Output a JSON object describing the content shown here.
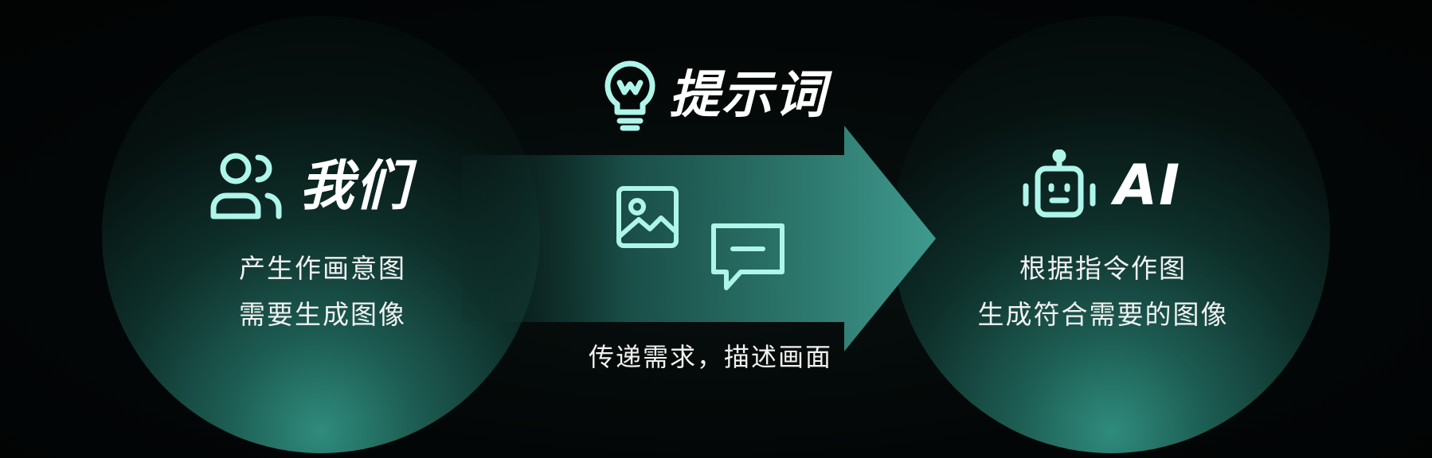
{
  "left_node": {
    "title": "我们",
    "icon": "users-icon",
    "lines": [
      "产生作画意图",
      "需要生成图像"
    ]
  },
  "center": {
    "title": "提示词",
    "title_icon": "lightbulb-icon",
    "icons": [
      "image-icon",
      "message-icon"
    ],
    "caption": "传递需求，描述画面"
  },
  "right_node": {
    "title": "AI",
    "icon": "robot-icon",
    "lines": [
      "根据指令作图",
      "生成符合需要的图像"
    ]
  },
  "colors": {
    "accent": "#aef5ea",
    "circle_glow": "#2f8c7d",
    "arrow": "#3a8f84",
    "background": "#030606"
  }
}
